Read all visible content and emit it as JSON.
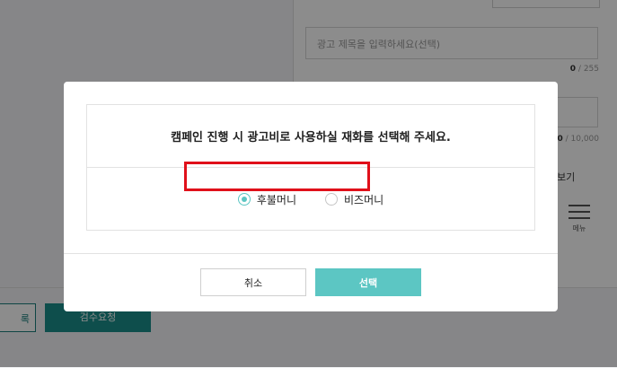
{
  "background": {
    "title_placeholder": "광고 제목을 입력하세요(선택)",
    "title_counter_current": "0",
    "title_counter_max": "/ 255",
    "desc_counter_current": "0",
    "desc_counter_max": "/ 10,000",
    "preview_label": "보기",
    "menu_label": "메뉴",
    "prev_button": "록",
    "review_button": "검수요청"
  },
  "modal": {
    "question": "캠페인 진행 시 광고비로 사용하실 재화를 선택해 주세요.",
    "options": [
      {
        "label": "후불머니",
        "checked": true
      },
      {
        "label": "비즈머니",
        "checked": false
      }
    ],
    "cancel_label": "취소",
    "select_label": "선택"
  },
  "colors": {
    "accent": "#5cc6c3",
    "highlight": "#e0101a",
    "primary_dark": "#1a8f8b"
  }
}
